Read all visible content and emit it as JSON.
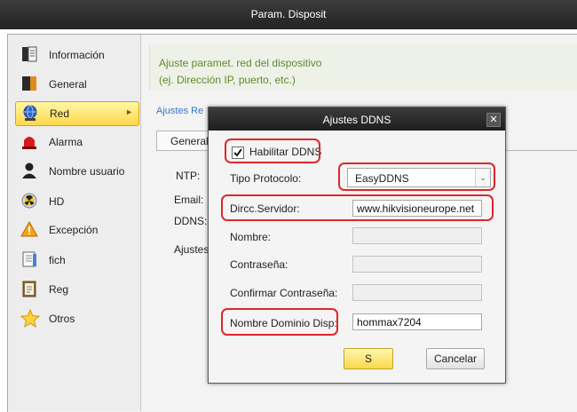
{
  "window": {
    "title": "Param. Disposit"
  },
  "sidebar": {
    "items": [
      {
        "label": "Información",
        "icon": "info-book-icon"
      },
      {
        "label": "General",
        "icon": "general-book-icon"
      },
      {
        "label": "Red",
        "icon": "network-globe-icon",
        "active": true
      },
      {
        "label": "Alarma",
        "icon": "alarm-siren-icon"
      },
      {
        "label": "Nombre usuario",
        "icon": "user-icon"
      },
      {
        "label": "HD",
        "icon": "hdd-radiation-icon"
      },
      {
        "label": "Excepción",
        "icon": "warning-icon"
      },
      {
        "label": "fich",
        "icon": "file-icon"
      },
      {
        "label": "Reg",
        "icon": "log-icon"
      },
      {
        "label": "Otros",
        "icon": "star-icon"
      }
    ]
  },
  "main": {
    "desc_line1": "Ajuste paramet. red del dispositivo",
    "desc_line2": "(ej. Dirección IP, puerto, etc.)",
    "breadcrumb": "Ajustes Re",
    "tab_general": "General",
    "fields": {
      "ntp": "NTP:",
      "email": "Email:",
      "ddns": "DDNS:",
      "ajustes": "Ajustes"
    }
  },
  "dialog": {
    "title": "Ajustes DDNS",
    "enable_label": "Habilitar DDNS",
    "enable_checked": true,
    "protocol_label": "Tipo Protocolo:",
    "protocol_value": "EasyDDNS",
    "server_label": "Dircc.Servidor:",
    "server_value": "www.hikvisioneurope.net",
    "name_label": "Nombre:",
    "password_label": "Contraseña:",
    "confirm_label": "Confirmar Contraseña:",
    "domain_label": "Nombre Dominio Disp:",
    "domain_value": "hommax7204",
    "ok_label": "S",
    "cancel_label": "Cancelar"
  },
  "colors": {
    "highlight_red": "#e0262a",
    "active_yellow": "#ffd84a",
    "desc_green": "#5f8a2e",
    "link_blue": "#3a78c4",
    "titlebar_dark": "#2a2a2a"
  }
}
